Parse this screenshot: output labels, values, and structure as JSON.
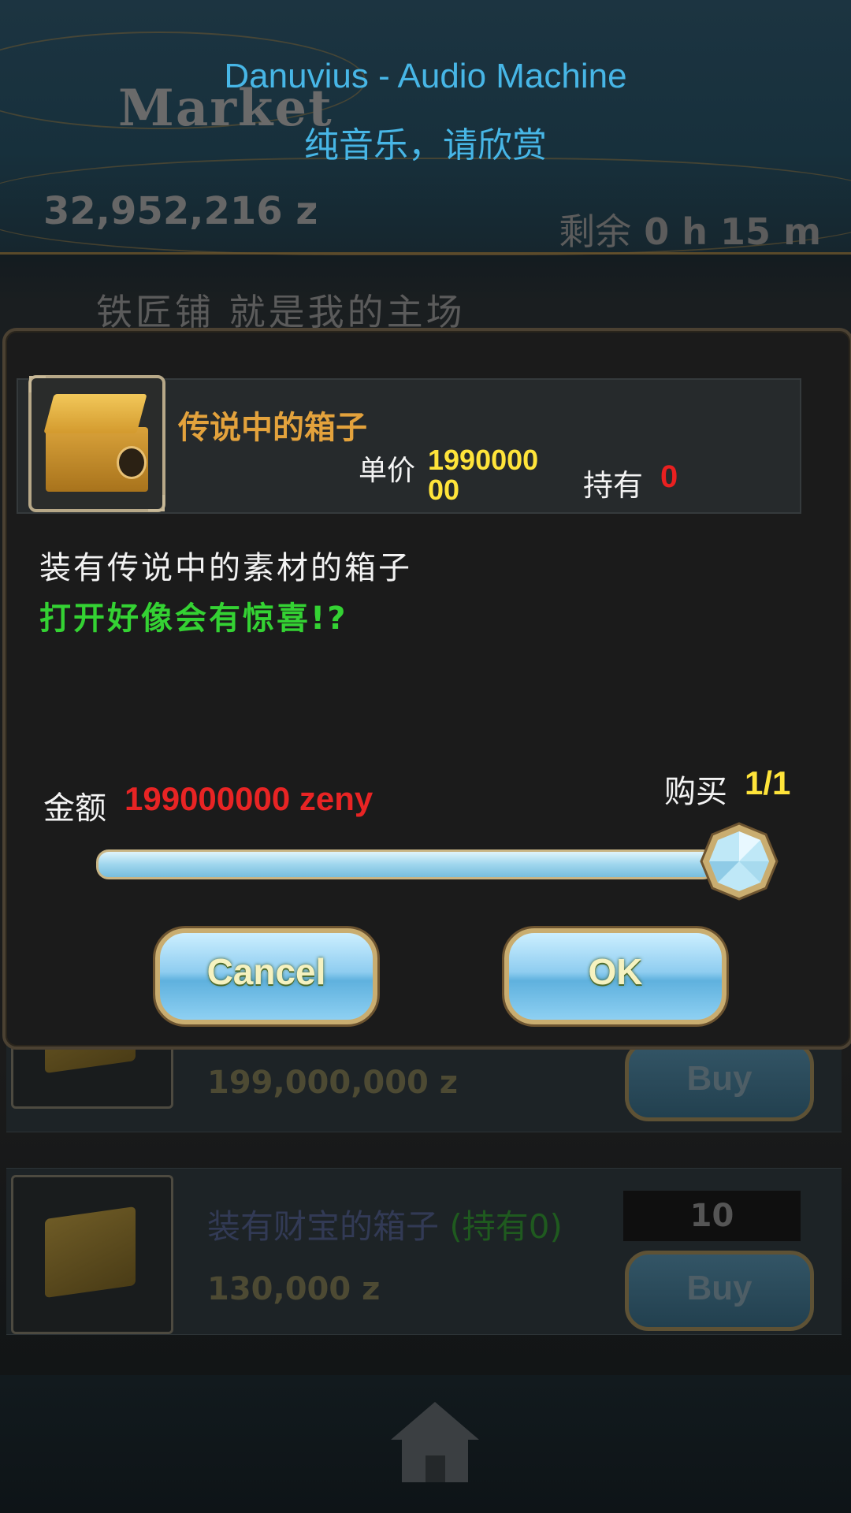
{
  "caption": {
    "song_title": "Danuvius - Audio Machine",
    "song_subtitle": "纯音乐，请欣赏"
  },
  "market": {
    "title": "Market",
    "zeny_total": "32,952,216 z",
    "time_left_label": "剩余",
    "time_left_value": "0 h 15 m",
    "shop_name": "铁匠铺 就是我的主场"
  },
  "list": [
    {
      "price": "199,000,000 z",
      "buy_label": "Buy"
    },
    {
      "name": "装有财宝的箱子",
      "owned": "(持有0)",
      "quantity": "10",
      "price": "130,000 z",
      "buy_label": "Buy"
    }
  ],
  "dialog": {
    "item_name": "传说中的箱子",
    "unit_price_label": "单价",
    "unit_price_value": "199000000",
    "own_label": "持有",
    "own_value": "0",
    "description_line1": "装有传说中的素材的箱子",
    "description_line2": "打开好像会有惊喜!?",
    "amount_label": "金额",
    "amount_value": "199000000 zeny",
    "buy_label": "购买",
    "buy_count": "1/1",
    "slider_fraction": 1.0,
    "cancel_label": "Cancel",
    "ok_label": "OK"
  },
  "colors": {
    "caption": "#47b6e6",
    "item_name": "#e3a23c",
    "price_yellow": "#ffe43a",
    "alert_red": "#e92020",
    "desc_green": "#34d233"
  },
  "icons": [
    "treasure-box-icon",
    "slider-gem-icon",
    "home-icon"
  ]
}
